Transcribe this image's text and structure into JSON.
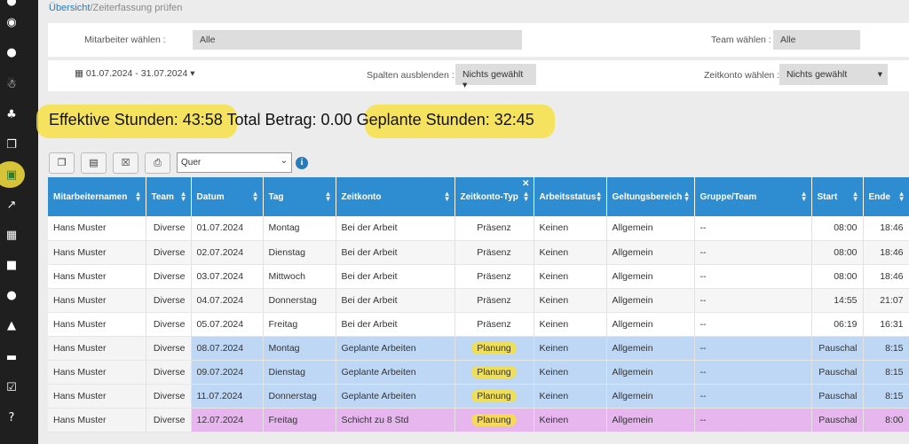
{
  "breadcrumb": {
    "link": "Übersicht",
    "rest": "/Zeiterfassung prüfen"
  },
  "filters": {
    "employee_label": "Mitarbeiter wählen :",
    "employee_value": "Alle",
    "team_label": "Team wählen :",
    "team_value": "Alle",
    "date_range": "01.07.2024 - 31.07.2024",
    "columns_label": "Spalten ausblenden :",
    "columns_value": "Nichts gewählt",
    "account_label": "Zeitkonto wählen :",
    "account_value": "Nichts gewählt"
  },
  "stats": {
    "effective": "Effektive Stunden: 43:58",
    "total": "Total Betrag: 0.00",
    "planned": "Geplante Stunden: 32:45"
  },
  "toolbar": {
    "orientation": "Quer",
    "icons": [
      "copy-icon",
      "document-icon",
      "excel-icon",
      "pdf-icon"
    ]
  },
  "table": {
    "headers": [
      "Mitarbeiternamen",
      "Team",
      "Datum",
      "Tag",
      "Zeitkonto",
      "Zeitkonto-Typ",
      "Arbeitsstatus",
      "Geltungsbereich",
      "Gruppe/Team",
      "Start",
      "Ende"
    ],
    "rows": [
      [
        "Hans Muster",
        "Diverse",
        "01.07.2024",
        "Montag",
        "Bei der Arbeit",
        "Präsenz",
        "Keinen",
        "Allgemein",
        "--",
        "08:00",
        "18:46"
      ],
      [
        "Hans Muster",
        "Diverse",
        "02.07.2024",
        "Dienstag",
        "Bei der Arbeit",
        "Präsenz",
        "Keinen",
        "Allgemein",
        "--",
        "08:00",
        "18:46"
      ],
      [
        "Hans Muster",
        "Diverse",
        "03.07.2024",
        "Mittwoch",
        "Bei der Arbeit",
        "Präsenz",
        "Keinen",
        "Allgemein",
        "--",
        "08:00",
        "18:46"
      ],
      [
        "Hans Muster",
        "Diverse",
        "04.07.2024",
        "Donnerstag",
        "Bei der Arbeit",
        "Präsenz",
        "Keinen",
        "Allgemein",
        "--",
        "14:55",
        "21:07"
      ],
      [
        "Hans Muster",
        "Diverse",
        "05.07.2024",
        "Freitag",
        "Bei der Arbeit",
        "Präsenz",
        "Keinen",
        "Allgemein",
        "--",
        "06:19",
        "16:31"
      ],
      [
        "Hans Muster",
        "Diverse",
        "08.07.2024",
        "Montag",
        "Geplante Arbeiten",
        "Planung",
        "Keinen",
        "Allgemein",
        "--",
        "Pauschal",
        "8:15"
      ],
      [
        "Hans Muster",
        "Diverse",
        "09.07.2024",
        "Dienstag",
        "Geplante Arbeiten",
        "Planung",
        "Keinen",
        "Allgemein",
        "--",
        "Pauschal",
        "8:15"
      ],
      [
        "Hans Muster",
        "Diverse",
        "11.07.2024",
        "Donnerstag",
        "Geplante Arbeiten",
        "Planung",
        "Keinen",
        "Allgemein",
        "--",
        "Pauschal",
        "8:15"
      ],
      [
        "Hans Muster",
        "Diverse",
        "12.07.2024",
        "Freitag",
        "Schicht zu 8 Std",
        "Planung",
        "Keinen",
        "Allgemein",
        "--",
        "Pauschal",
        "8:00"
      ]
    ]
  },
  "sidebar_icons": [
    "dashboard-icon",
    "user-icon",
    "person-icon",
    "group-icon",
    "copy-icon",
    "timesheet-icon",
    "chart-icon",
    "calendar-icon",
    "briefcase-icon",
    "location-icon",
    "lock-icon",
    "card-icon",
    "checkbox-icon",
    "help-icon"
  ],
  "colors": {
    "header_blue": "#2e8cd1",
    "plan_row": "#bdd7f5",
    "shift_row": "#e7b6ef",
    "highlight": "#f8e13c"
  }
}
